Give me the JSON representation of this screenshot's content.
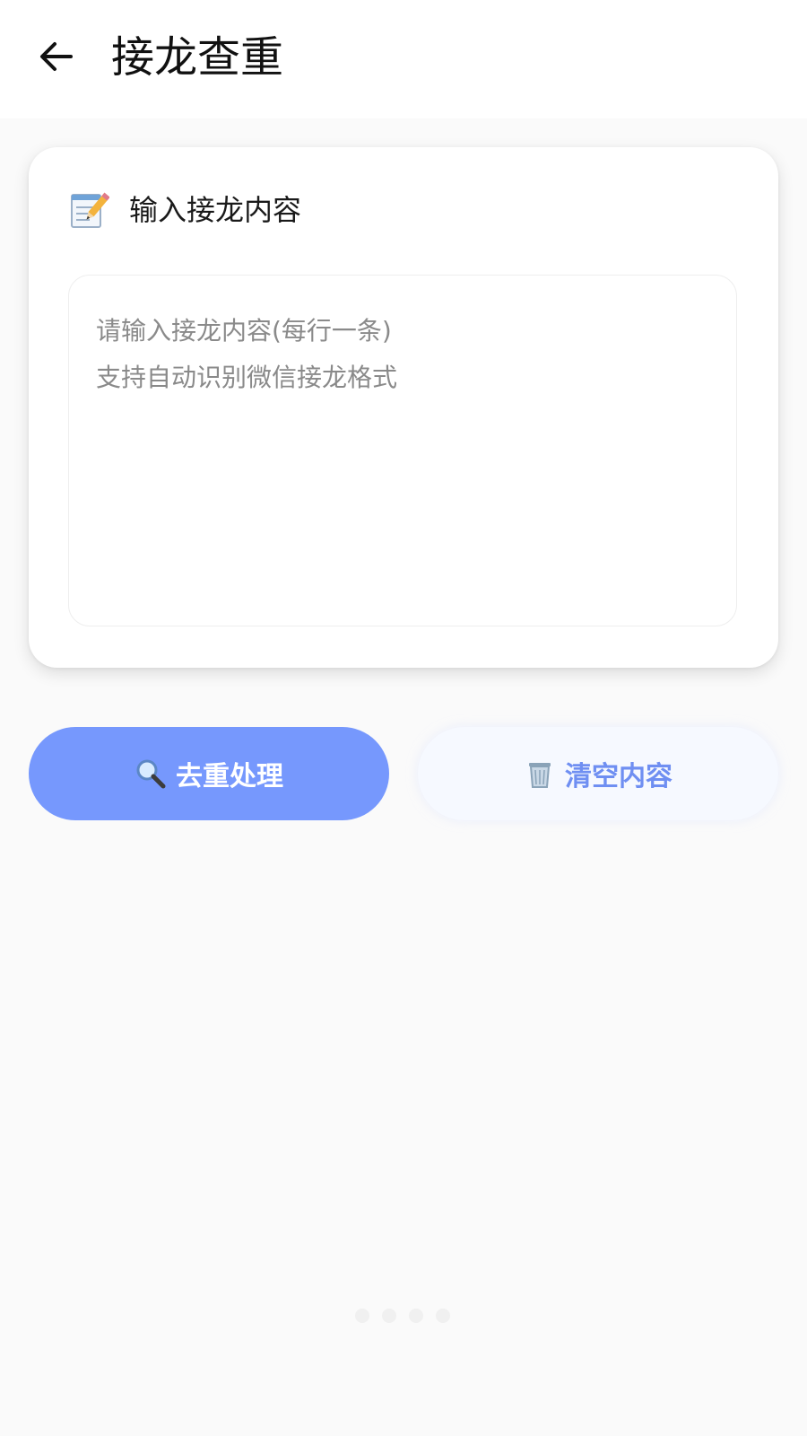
{
  "header": {
    "title": "接龙查重"
  },
  "card": {
    "title": "输入接龙内容",
    "input": {
      "value": "",
      "placeholder": "请输入接龙内容(每行一条)\n支持自动识别微信接龙格式"
    }
  },
  "actions": {
    "dedupe_label": "去重处理",
    "clear_label": "清空内容"
  },
  "colors": {
    "primary": "#7698fd",
    "secondary_bg": "#f6f9ff",
    "secondary_text": "#6f8ff2"
  },
  "icons": {
    "back": "arrow-left-icon",
    "memo": "memo-icon",
    "search": "magnifier-icon",
    "trash": "wastebasket-icon"
  }
}
